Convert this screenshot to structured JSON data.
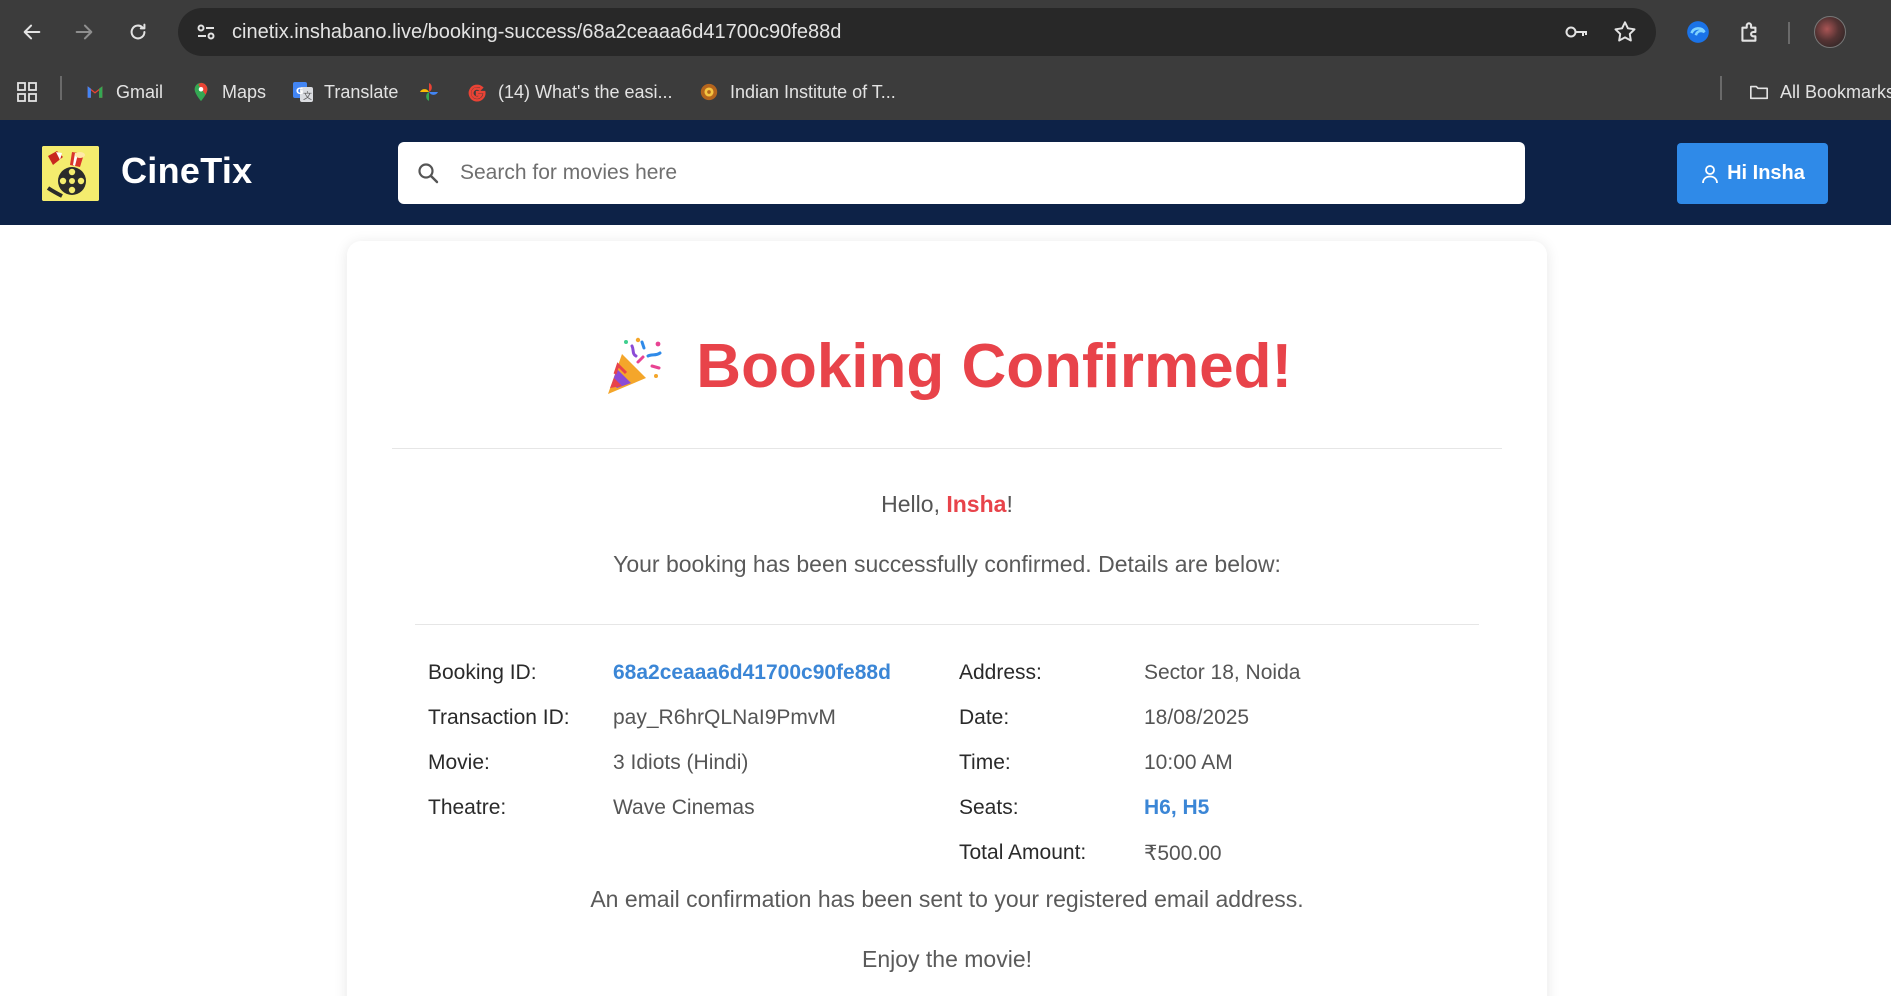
{
  "browser": {
    "url": "cinetix.inshabano.live/booking-success/68a2ceaaa6d41700c90fe88d",
    "bookmarks": [
      {
        "label": "Gmail",
        "icon": "gmail-icon"
      },
      {
        "label": "Maps",
        "icon": "maps-icon"
      },
      {
        "label": "Translate",
        "icon": "translate-icon"
      },
      {
        "label": "",
        "icon": "photos-icon"
      },
      {
        "label": "(14) What's the easi...",
        "icon": "google-icon"
      },
      {
        "label": "Indian Institute of T...",
        "icon": "iit-icon"
      }
    ],
    "all_bookmarks": "All Bookmarks"
  },
  "header": {
    "brand": "CineTix",
    "search_placeholder": "Search for movies here",
    "user_button": "Hi Insha"
  },
  "booking": {
    "title": "Booking Confirmed!",
    "greeting_prefix": "Hello, ",
    "user_name": "Insha",
    "greeting_suffix": "!",
    "message": "Your booking has been successfully confirmed. Details are below:",
    "details_left": [
      {
        "label": "Booking ID:",
        "value": "68a2ceaaa6d41700c90fe88d"
      },
      {
        "label": "Transaction ID:",
        "value": "pay_R6hrQLNaI9PmvM"
      },
      {
        "label": "Movie:",
        "value": "3 Idiots (Hindi)"
      },
      {
        "label": "Theatre:",
        "value": "Wave Cinemas"
      }
    ],
    "details_right": [
      {
        "label": "Address:",
        "value": "Sector 18, Noida"
      },
      {
        "label": "Date:",
        "value": "18/08/2025"
      },
      {
        "label": "Time:",
        "value": "10:00 AM"
      },
      {
        "label": "Seats:",
        "value": "H6, H5"
      },
      {
        "label": "Total Amount:",
        "value": "₹500.00"
      }
    ],
    "email_note": "An email confirmation has been sent to your registered email address.",
    "footer": "Enjoy the movie!"
  },
  "colors": {
    "header_bg": "#0d2247",
    "accent_red": "#e8434a",
    "link_blue": "#3b86d6",
    "button_blue": "#2f8ae8"
  }
}
